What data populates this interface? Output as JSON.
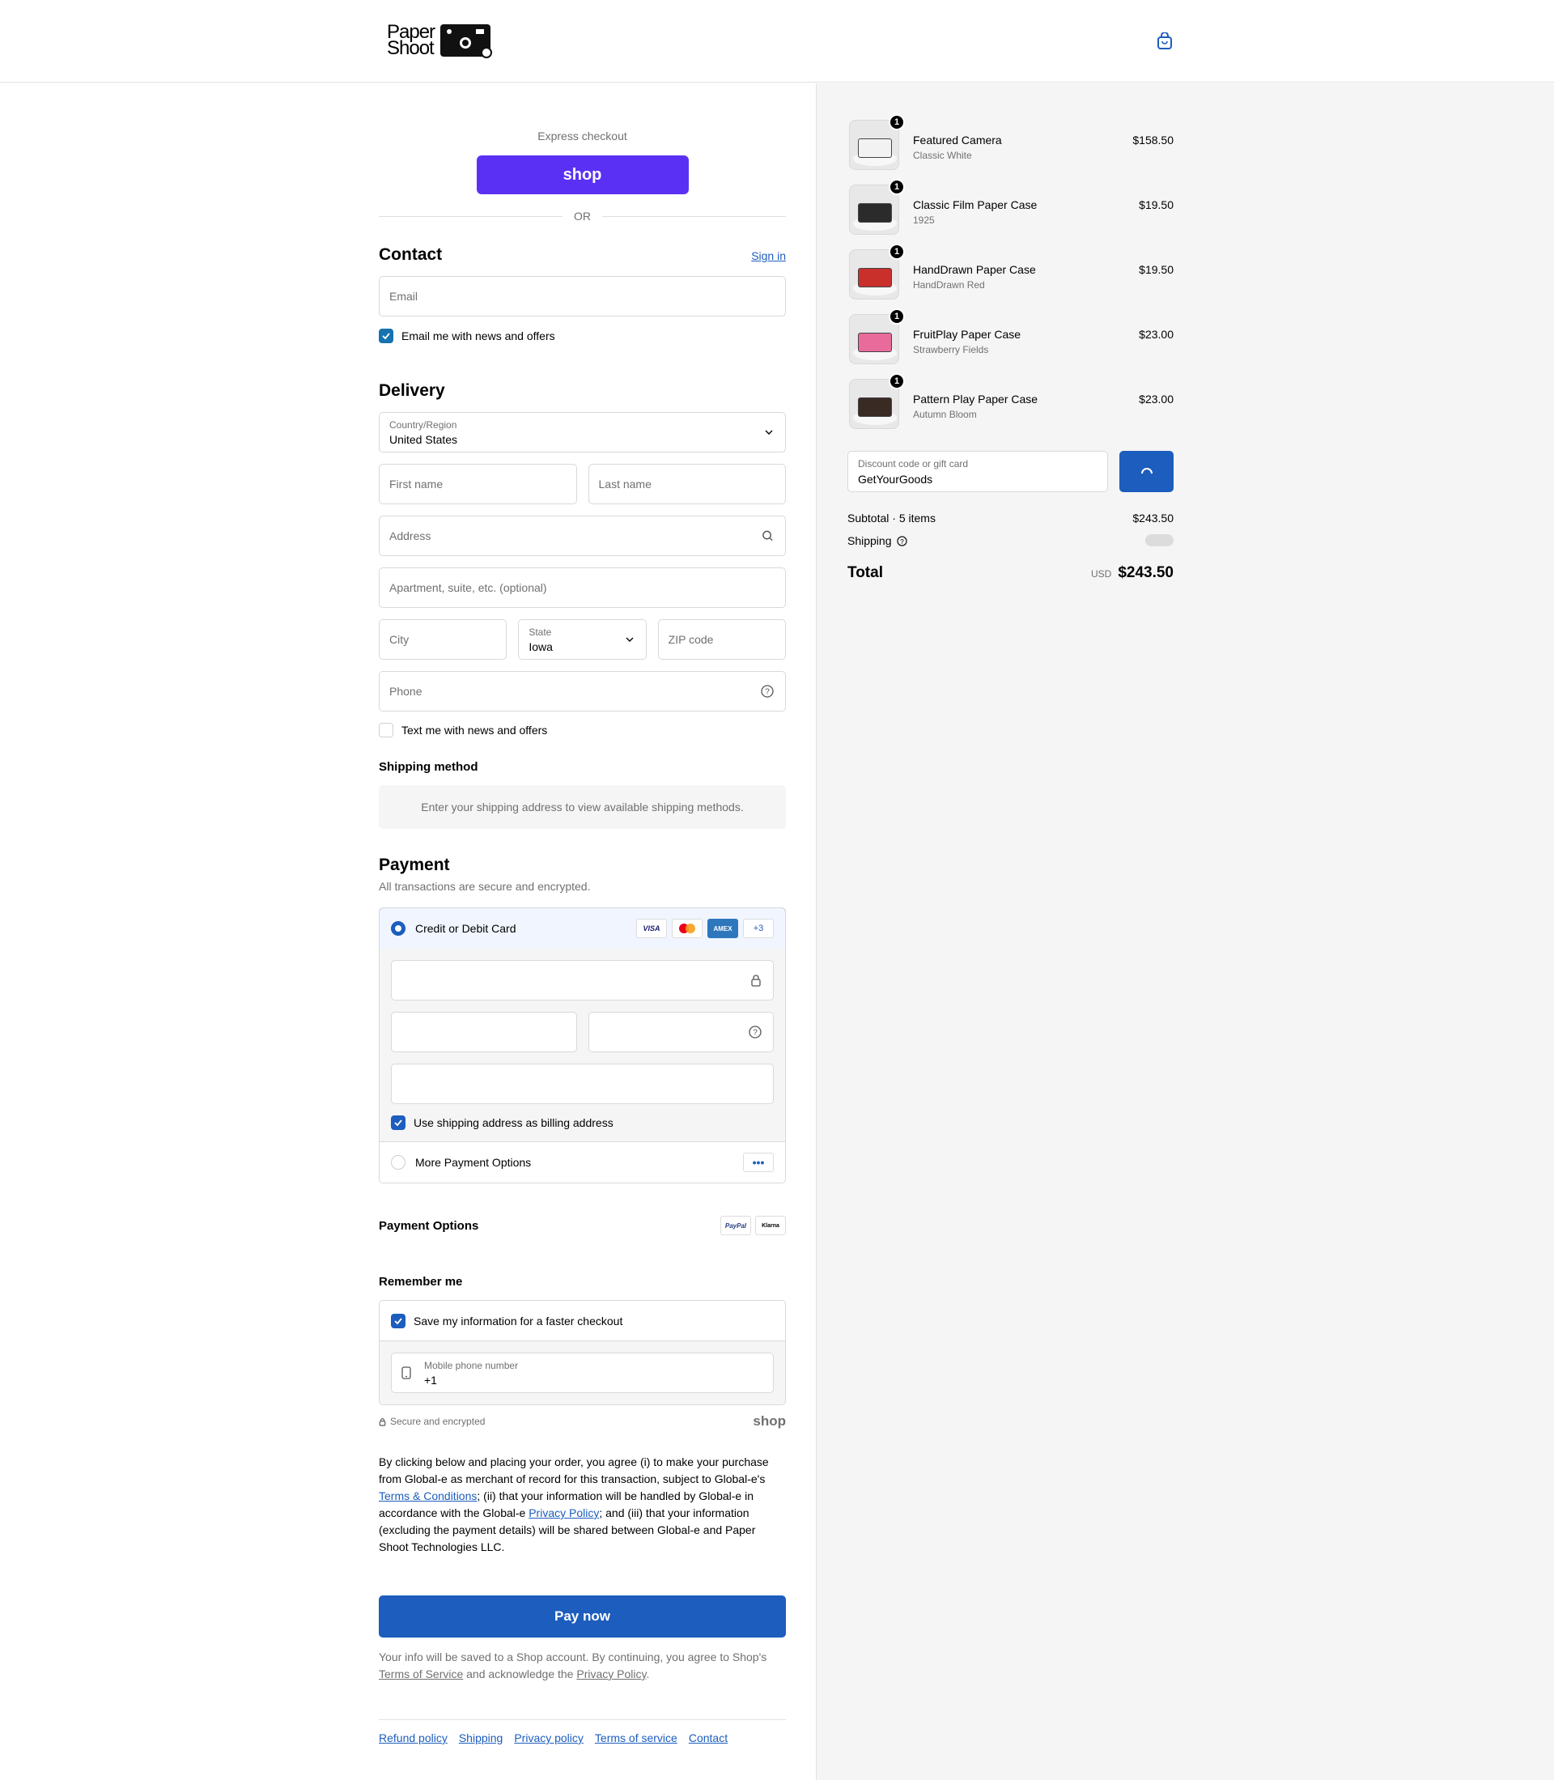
{
  "brand": {
    "logo_text": "Paper Shoot"
  },
  "express": {
    "label": "Express checkout",
    "shop_label": "shop",
    "or_label": "OR"
  },
  "contact": {
    "title": "Contact",
    "sign_in": "Sign in",
    "email_placeholder": "Email",
    "newsletter_label": "Email me with news and offers",
    "newsletter_checked": true
  },
  "delivery": {
    "title": "Delivery",
    "country_label": "Country/Region",
    "country_value": "United States",
    "first_name_placeholder": "First name",
    "last_name_placeholder": "Last name",
    "address_placeholder": "Address",
    "apartment_placeholder": "Apartment, suite, etc. (optional)",
    "city_placeholder": "City",
    "state_label": "State",
    "state_value": "Iowa",
    "zip_placeholder": "ZIP code",
    "phone_placeholder": "Phone",
    "sms_label": "Text me with news and offers",
    "sms_checked": false
  },
  "shipping_method": {
    "title": "Shipping method",
    "info": "Enter your shipping address to view available shipping methods."
  },
  "payment": {
    "title": "Payment",
    "subtitle": "All transactions are secure and encrypted.",
    "card_option": "Credit or Debit Card",
    "card_brands": [
      "VISA",
      "Mastercard",
      "AMEX"
    ],
    "more_cards": "+3",
    "billing_label": "Use shipping address as billing address",
    "billing_checked": true,
    "more_options": "More Payment Options"
  },
  "payment_options": {
    "title": "Payment Options",
    "brands": [
      "PayPal",
      "Klarna"
    ]
  },
  "remember": {
    "title": "Remember me",
    "save_label": "Save my information for a faster checkout",
    "save_checked": true,
    "mobile_label": "Mobile phone number",
    "mobile_value": "+1",
    "secure_label": "Secure and encrypted",
    "shop_label": "shop"
  },
  "legal": {
    "part1": "By clicking below and placing your order, you agree (i) to make your purchase from Global-e as merchant of record for this transaction, subject to Global-e's ",
    "terms_link": "Terms & Conditions",
    "part2": "; (ii) that your information will be handled by Global-e in accordance with the Global-e ",
    "privacy_link": "Privacy Policy",
    "part3": "; and (iii) that your information (excluding the payment details) will be shared between Global-e and Paper Shoot Technologies LLC."
  },
  "pay_now": "Pay now",
  "shop_notice": {
    "part1": "Your info will be saved to a Shop account. By continuing, you agree to Shop's ",
    "tos_link": "Terms of Service",
    "part2": " and acknowledge the ",
    "privacy_link": "Privacy Policy",
    "part3": "."
  },
  "footer": [
    "Refund policy",
    "Shipping",
    "Privacy policy",
    "Terms of service",
    "Contact"
  ],
  "order": {
    "items": [
      {
        "name": "Featured Camera",
        "variant": "Classic White",
        "price": "$158.50",
        "qty": "1",
        "color": "#f2f2f2"
      },
      {
        "name": "Classic Film Paper Case",
        "variant": "1925",
        "price": "$19.50",
        "qty": "1",
        "color": "#2b2b2b"
      },
      {
        "name": "HandDrawn Paper Case",
        "variant": "HandDrawn Red",
        "price": "$19.50",
        "qty": "1",
        "color": "#c9302c"
      },
      {
        "name": "FruitPlay Paper Case",
        "variant": "Strawberry Fields",
        "price": "$23.00",
        "qty": "1",
        "color": "#e86b9b"
      },
      {
        "name": "Pattern Play Paper Case",
        "variant": "Autumn Bloom",
        "price": "$23.00",
        "qty": "1",
        "color": "#3a2a24"
      }
    ],
    "discount_label": "Discount code or gift card",
    "discount_value": "GetYourGoods",
    "subtotal_label": "Subtotal · 5 items",
    "subtotal_value": "$243.50",
    "shipping_label": "Shipping",
    "total_label": "Total",
    "currency": "USD",
    "total_value": "$243.50"
  },
  "colors": {
    "accent": "#1c5dbd",
    "shop_purple": "#5a31f4",
    "checkbox": "#1773b0"
  }
}
